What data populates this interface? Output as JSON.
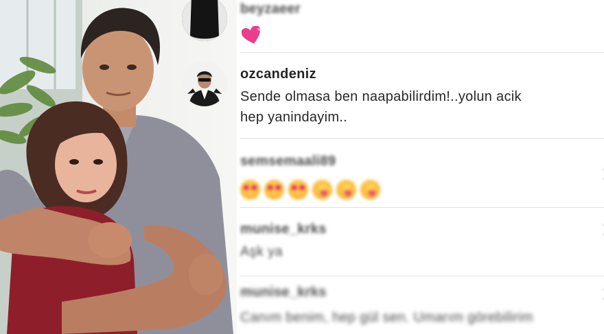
{
  "comments": [
    {
      "username": "beyzaeer",
      "text": ""
    },
    {
      "username": "ozcandeniz",
      "text_line1": "Sende olmasa ben naapabilirdim!..yolun acik",
      "text_line2": "hep yanindayim.."
    },
    {
      "username": "semsemaali89",
      "text": ""
    },
    {
      "username": "munise_krks",
      "text": "Aşk ya"
    },
    {
      "username": "munise_krks",
      "text": "Canım benim, hep gül sen. Umarım görebilirim"
    }
  ],
  "colors": {
    "text": "#262626",
    "divider": "#e1e1e1",
    "heart": "#e83e8c"
  },
  "icons": [
    "pink-heart-icon",
    "heart-eyes-emoji",
    "kiss-wink-emoji",
    "chevron-right-icon"
  ]
}
